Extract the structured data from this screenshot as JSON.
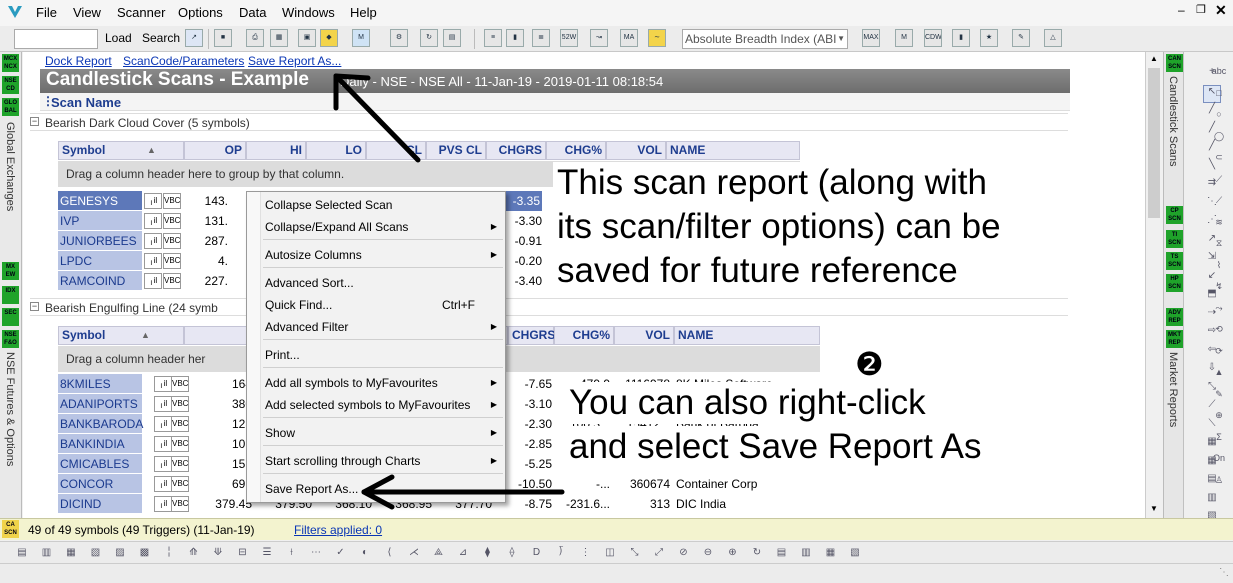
{
  "menu": {
    "items": [
      "File",
      "View",
      "Scanner",
      "Options",
      "Data",
      "Windows",
      "Help"
    ]
  },
  "toolbar": {
    "load_label": "Load",
    "search_label": "Search",
    "breadth_select": "Absolute Breadth Index (ABI"
  },
  "toolbar_icons": {
    "a": "52W HILO",
    "b": "MA",
    "c": "MAX FIB",
    "d": "M PVT",
    "e": "CDW TAM"
  },
  "left_strip": {
    "buttons": [
      "MCX NCX",
      "NSE CD",
      "GLO BAL",
      "MX EW",
      "IDX",
      "SEC",
      "NSE F&O"
    ],
    "labels": [
      "Global Exchanges",
      "NSE Futures & Options"
    ]
  },
  "right_strip": {
    "buttons": [
      "CAN SCN",
      "CP SCN",
      "TI SCN",
      "TS SCN",
      "HP SCN",
      "ADV REP",
      "MKT REP"
    ],
    "labels": [
      "Candlestick Scans",
      "Market Reports"
    ]
  },
  "links": {
    "dock": "Dock Report",
    "scancode": "ScanCode/Parameters",
    "save_as": "Save Report As..."
  },
  "report": {
    "title": "Candlestick Scans - Example",
    "subtitle": "Daily - NSE - NSE All - 11-Jan-19 - 2019-01-11 08:18:54",
    "scan_name_header": "Scan Name"
  },
  "group1": {
    "name": "Bearish Dark Cloud Cover (5 symbols)",
    "columns": {
      "symbol": "Symbol",
      "op": "OP",
      "hi": "HI",
      "lo": "LO",
      "cl": "CL",
      "pvscl": "PVS CL",
      "chgrs": "CHGRS",
      "chgpct": "CHG%",
      "vol": "VOL",
      "name": "NAME"
    },
    "drag_text": "Drag a column header here to group by that column.",
    "rows": [
      {
        "symbol": "GENESYS",
        "op": "143.",
        "chg": "-3.35"
      },
      {
        "symbol": "IVP",
        "op": "131.",
        "chg": "-3.30"
      },
      {
        "symbol": "JUNIORBEES",
        "op": "287.",
        "chg": "-0.91"
      },
      {
        "symbol": "LPDC",
        "op": "4.",
        "chg": "-0.20"
      },
      {
        "symbol": "RAMCOIND",
        "op": "227.",
        "chg": "-3.40"
      }
    ]
  },
  "group2": {
    "name": "Bearish Engulfing Line (24 symb",
    "columns": {
      "symbol": "Symbol",
      "chgrs": "CHGRS",
      "chgpct": "CHG%",
      "vol": "VOL",
      "name": "NAME"
    },
    "drag_text": "Drag a column header her",
    "rows": [
      {
        "symbol": "8KMILES",
        "op": "164",
        "hi": "",
        "lo": "",
        "cl": "",
        "pv": "",
        "chg": "-7.65",
        "pct": "-479.9",
        "vol": "1116978",
        "name": "8K Miles Software"
      },
      {
        "symbol": "ADANIPORTS",
        "op": "380",
        "hi": "",
        "lo": "",
        "cl": "",
        "pv": "",
        "chg": "-3.10",
        "pct": "",
        "vol": "",
        "name": ""
      },
      {
        "symbol": "BANKBARODA",
        "op": "123",
        "hi": "",
        "lo": "",
        "cl": "",
        "pv": "",
        "chg": "-2.30",
        "pct": "100.3...",
        "vol": "15412...",
        "name": "Bank of Baroda"
      },
      {
        "symbol": "BANKINDIA",
        "op": "106",
        "hi": "",
        "lo": "",
        "cl": "",
        "pv": "",
        "chg": "-2.85",
        "pct": "",
        "vol": "",
        "name": ""
      },
      {
        "symbol": "CMICABLES",
        "op": "157",
        "hi": "",
        "lo": "",
        "cl": "",
        "pv": "",
        "chg": "-5.25",
        "pct": "",
        "vol": "",
        "name": ""
      },
      {
        "symbol": "CONCOR",
        "op": "691",
        "hi": "",
        "lo": "",
        "cl": "",
        "pv": "",
        "chg": "-10.50",
        "pct": "-...",
        "vol": "360674",
        "name": "Container Corp"
      },
      {
        "symbol": "DICIND",
        "op": "379.45",
        "hi": "379.50",
        "lo": "368.10",
        "cl": "368.95",
        "pv": "377.70",
        "chg": "-8.75",
        "pct": "-231.6...",
        "vol": "313",
        "name": "DIC India"
      }
    ]
  },
  "context_menu": {
    "items": [
      {
        "label": "Collapse Selected Scan",
        "shortcut": "",
        "sub": false
      },
      {
        "label": "Collapse/Expand All Scans",
        "shortcut": "",
        "sub": true
      },
      {
        "label": "Autosize Columns",
        "shortcut": "",
        "sub": true
      },
      {
        "label": "Advanced Sort...",
        "shortcut": "",
        "sub": false
      },
      {
        "label": "Quick Find...",
        "shortcut": "Ctrl+F",
        "sub": false
      },
      {
        "label": "Advanced Filter",
        "shortcut": "",
        "sub": true
      },
      {
        "label": "Print...",
        "shortcut": "",
        "sub": false
      },
      {
        "label": "Add all symbols to MyFavourites",
        "shortcut": "",
        "sub": true
      },
      {
        "label": "Add selected symbols to MyFavourites",
        "shortcut": "",
        "sub": true
      },
      {
        "label": "Show",
        "shortcut": "",
        "sub": true
      },
      {
        "label": "Start scrolling through Charts",
        "shortcut": "",
        "sub": true
      },
      {
        "label": "Save Report As...",
        "shortcut": "",
        "sub": false
      }
    ]
  },
  "annotations": {
    "a1_l1": "This scan report (along with",
    "a1_l2": "its scan/filter options) can be",
    "a1_l3": "saved for future reference",
    "marker": "❷",
    "a2_l1": "You can also right-click",
    "a2_l2": "and select Save Report As"
  },
  "status": {
    "left": "49 of 49 symbols (49 Triggers) (11-Jan-19)",
    "filters": "Filters applied: 0"
  },
  "colors": {
    "accent": "#1e3d8f",
    "selected_row": "#5d78b9",
    "symbol_cell": "#b8c4e4",
    "title_bar": "#7a7a7a"
  }
}
